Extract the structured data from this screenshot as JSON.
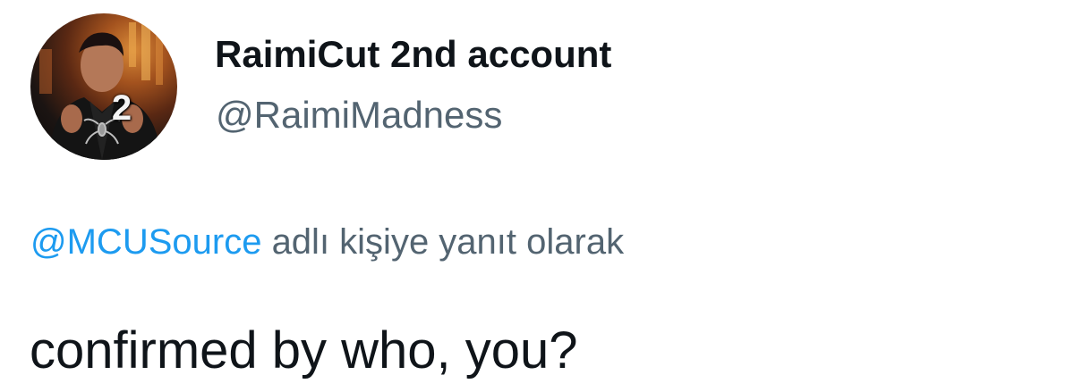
{
  "tweet": {
    "author": {
      "display_name": "RaimiCut 2nd account",
      "handle": "@RaimiMadness",
      "avatar_badge": "2"
    },
    "reply_to": {
      "mention": "@MCUSource",
      "suffix": "adlı kişiye yanıt olarak"
    },
    "text": "confirmed by who, you?"
  },
  "colors": {
    "primary_text": "#0f1419",
    "secondary_text": "#536471",
    "link": "#1d9bf0",
    "background": "#ffffff"
  }
}
